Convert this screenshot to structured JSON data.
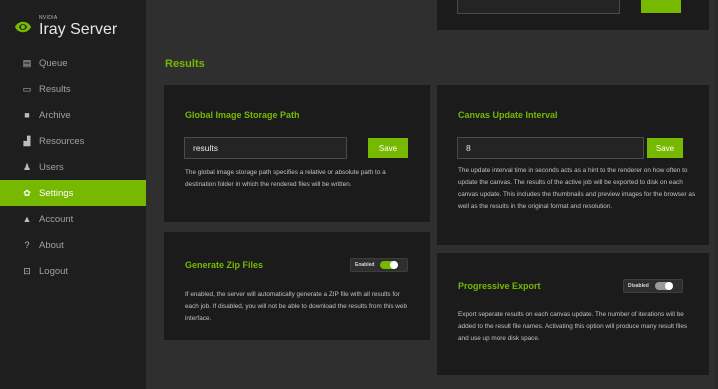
{
  "brand": {
    "vendor": "NVIDIA",
    "product": "Iray Server"
  },
  "sidebar": {
    "items": [
      {
        "label": "Queue",
        "icon": "queue-icon",
        "glyph": "▤"
      },
      {
        "label": "Results",
        "icon": "results-icon",
        "glyph": "▭"
      },
      {
        "label": "Archive",
        "icon": "archive-icon",
        "glyph": "■"
      },
      {
        "label": "Resources",
        "icon": "resources-icon",
        "glyph": "▟"
      },
      {
        "label": "Users",
        "icon": "users-icon",
        "glyph": "♟"
      },
      {
        "label": "Settings",
        "icon": "gear-icon",
        "glyph": "✿",
        "active": true
      },
      {
        "label": "Account",
        "icon": "account-icon",
        "glyph": "▲"
      },
      {
        "label": "About",
        "icon": "question-icon",
        "glyph": "?"
      },
      {
        "label": "Logout",
        "icon": "logout-icon",
        "glyph": "⊡"
      }
    ]
  },
  "page": {
    "section_title": "Results"
  },
  "global_storage": {
    "title": "Global Image Storage Path",
    "value": "results",
    "save_label": "Save",
    "description": "The global image storage path specifies a relative or absolute path to a destination folder in which the rendered files will be written."
  },
  "canvas_interval": {
    "title": "Canvas Update Interval",
    "value": "8",
    "save_label": "Save",
    "description": "The update interval time in seconds acts as a hint to the renderer on how often to update the canvas. The results of the active job will be exported to disk on each canvas update. This includes the thumbnails and preview images for the browser as well as the results in the original format and resolution."
  },
  "zip_files": {
    "title": "Generate Zip Files",
    "toggle_label": "Enabled",
    "enabled": true,
    "description": "If enabled, the server will automatically generate a ZIP file with all results for each job. If disabled, you will not be able to download the results from this web interface."
  },
  "progressive_export": {
    "title": "Progressive Export",
    "toggle_label": "Disabled",
    "enabled": false,
    "description": "Export seperate results on each canvas update. The number of iterations will be added to the result file names. Activating this option will produce many result files and use up more disk space."
  },
  "colors": {
    "accent": "#76b900",
    "sidebar_bg": "#1e1e1e",
    "card_bg": "#1b1b1b",
    "page_bg": "#2f2f2f"
  }
}
